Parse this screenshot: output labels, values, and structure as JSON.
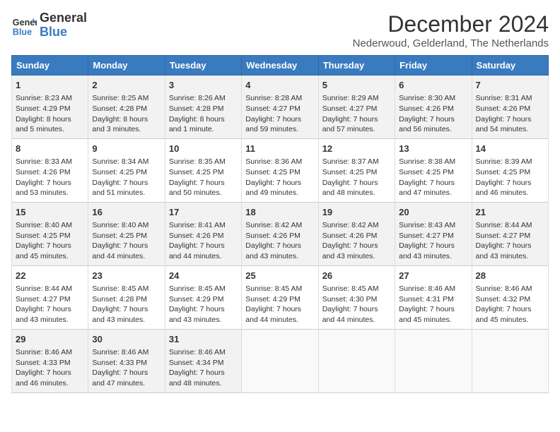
{
  "logo": {
    "line1": "General",
    "line2": "Blue"
  },
  "title": "December 2024",
  "location": "Nederwoud, Gelderland, The Netherlands",
  "days_of_week": [
    "Sunday",
    "Monday",
    "Tuesday",
    "Wednesday",
    "Thursday",
    "Friday",
    "Saturday"
  ],
  "weeks": [
    [
      {
        "day": 1,
        "sunrise": "8:23 AM",
        "sunset": "4:29 PM",
        "daylight": "8 hours and 5 minutes."
      },
      {
        "day": 2,
        "sunrise": "8:25 AM",
        "sunset": "4:28 PM",
        "daylight": "8 hours and 3 minutes."
      },
      {
        "day": 3,
        "sunrise": "8:26 AM",
        "sunset": "4:28 PM",
        "daylight": "8 hours and 1 minute."
      },
      {
        "day": 4,
        "sunrise": "8:28 AM",
        "sunset": "4:27 PM",
        "daylight": "7 hours and 59 minutes."
      },
      {
        "day": 5,
        "sunrise": "8:29 AM",
        "sunset": "4:27 PM",
        "daylight": "7 hours and 57 minutes."
      },
      {
        "day": 6,
        "sunrise": "8:30 AM",
        "sunset": "4:26 PM",
        "daylight": "7 hours and 56 minutes."
      },
      {
        "day": 7,
        "sunrise": "8:31 AM",
        "sunset": "4:26 PM",
        "daylight": "7 hours and 54 minutes."
      }
    ],
    [
      {
        "day": 8,
        "sunrise": "8:33 AM",
        "sunset": "4:26 PM",
        "daylight": "7 hours and 53 minutes."
      },
      {
        "day": 9,
        "sunrise": "8:34 AM",
        "sunset": "4:25 PM",
        "daylight": "7 hours and 51 minutes."
      },
      {
        "day": 10,
        "sunrise": "8:35 AM",
        "sunset": "4:25 PM",
        "daylight": "7 hours and 50 minutes."
      },
      {
        "day": 11,
        "sunrise": "8:36 AM",
        "sunset": "4:25 PM",
        "daylight": "7 hours and 49 minutes."
      },
      {
        "day": 12,
        "sunrise": "8:37 AM",
        "sunset": "4:25 PM",
        "daylight": "7 hours and 48 minutes."
      },
      {
        "day": 13,
        "sunrise": "8:38 AM",
        "sunset": "4:25 PM",
        "daylight": "7 hours and 47 minutes."
      },
      {
        "day": 14,
        "sunrise": "8:39 AM",
        "sunset": "4:25 PM",
        "daylight": "7 hours and 46 minutes."
      }
    ],
    [
      {
        "day": 15,
        "sunrise": "8:40 AM",
        "sunset": "4:25 PM",
        "daylight": "7 hours and 45 minutes."
      },
      {
        "day": 16,
        "sunrise": "8:40 AM",
        "sunset": "4:25 PM",
        "daylight": "7 hours and 44 minutes."
      },
      {
        "day": 17,
        "sunrise": "8:41 AM",
        "sunset": "4:26 PM",
        "daylight": "7 hours and 44 minutes."
      },
      {
        "day": 18,
        "sunrise": "8:42 AM",
        "sunset": "4:26 PM",
        "daylight": "7 hours and 43 minutes."
      },
      {
        "day": 19,
        "sunrise": "8:42 AM",
        "sunset": "4:26 PM",
        "daylight": "7 hours and 43 minutes."
      },
      {
        "day": 20,
        "sunrise": "8:43 AM",
        "sunset": "4:27 PM",
        "daylight": "7 hours and 43 minutes."
      },
      {
        "day": 21,
        "sunrise": "8:44 AM",
        "sunset": "4:27 PM",
        "daylight": "7 hours and 43 minutes."
      }
    ],
    [
      {
        "day": 22,
        "sunrise": "8:44 AM",
        "sunset": "4:27 PM",
        "daylight": "7 hours and 43 minutes."
      },
      {
        "day": 23,
        "sunrise": "8:45 AM",
        "sunset": "4:28 PM",
        "daylight": "7 hours and 43 minutes."
      },
      {
        "day": 24,
        "sunrise": "8:45 AM",
        "sunset": "4:29 PM",
        "daylight": "7 hours and 43 minutes."
      },
      {
        "day": 25,
        "sunrise": "8:45 AM",
        "sunset": "4:29 PM",
        "daylight": "7 hours and 44 minutes."
      },
      {
        "day": 26,
        "sunrise": "8:45 AM",
        "sunset": "4:30 PM",
        "daylight": "7 hours and 44 minutes."
      },
      {
        "day": 27,
        "sunrise": "8:46 AM",
        "sunset": "4:31 PM",
        "daylight": "7 hours and 45 minutes."
      },
      {
        "day": 28,
        "sunrise": "8:46 AM",
        "sunset": "4:32 PM",
        "daylight": "7 hours and 45 minutes."
      }
    ],
    [
      {
        "day": 29,
        "sunrise": "8:46 AM",
        "sunset": "4:33 PM",
        "daylight": "7 hours and 46 minutes."
      },
      {
        "day": 30,
        "sunrise": "8:46 AM",
        "sunset": "4:33 PM",
        "daylight": "7 hours and 47 minutes."
      },
      {
        "day": 31,
        "sunrise": "8:46 AM",
        "sunset": "4:34 PM",
        "daylight": "7 hours and 48 minutes."
      },
      null,
      null,
      null,
      null
    ]
  ],
  "labels": {
    "sunrise": "Sunrise:",
    "sunset": "Sunset:",
    "daylight": "Daylight:"
  }
}
